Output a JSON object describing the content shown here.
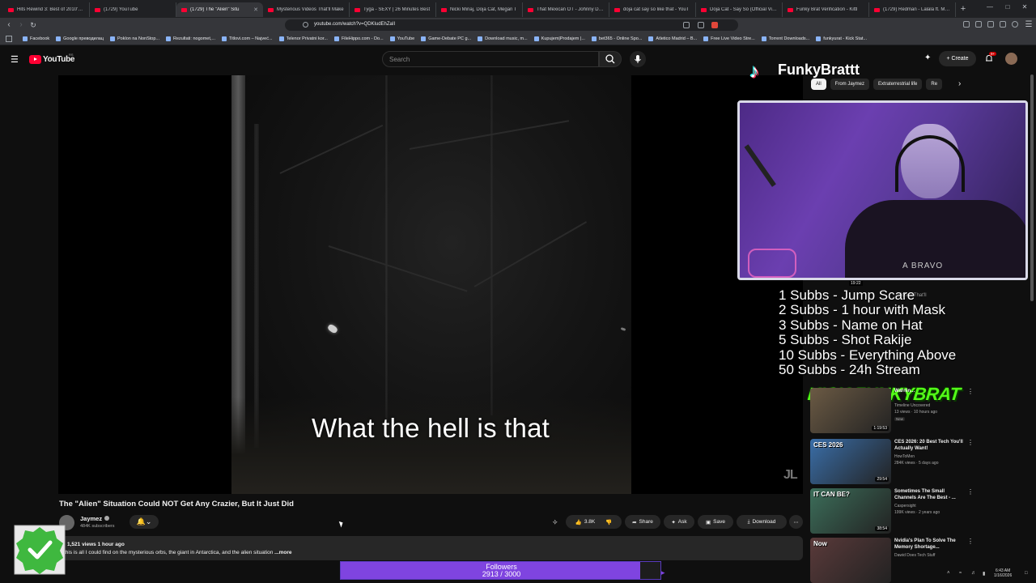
{
  "browser": {
    "tabs": [
      {
        "title": "Hits Rewind 3: Best of 2010's Hi",
        "active": false
      },
      {
        "title": "(1729) YouTube",
        "active": false
      },
      {
        "title": "(1729) The \"Alien\" Situ",
        "active": true
      },
      {
        "title": "Mysterious Videos That'll Make",
        "active": false
      },
      {
        "title": "Tyga - SEXY | 26 Minutes Best",
        "active": false
      },
      {
        "title": "Nicki Minaj, Doja Cat, Megan T",
        "active": false
      },
      {
        "title": "That Mexican OT - Johnny Dan",
        "active": false
      },
      {
        "title": "doja cat say so like that - YouT",
        "active": false
      },
      {
        "title": "Doja Cat - Say So (Official Vide",
        "active": false
      },
      {
        "title": "Funky Brat Verification - Kittl",
        "active": false
      },
      {
        "title": "(1729) Redman - Lalala ft. Meth",
        "active": false
      }
    ],
    "new_tab": "+",
    "url": "youtube.com/watch?v=QDKludEhZaII",
    "bookmarks": [
      "Facebook",
      "Google преводилац",
      "Poklon na NonStop...",
      "Rezultati: nogomet,...",
      "Titlovi.com – Najveć...",
      "Telenor Privatni kor...",
      "FileHippo.com - Do...",
      "YouTube",
      "Game-Debate PC g...",
      "Download music, m...",
      "Kupujem|Prodajem |...",
      "bet365 - Online Spo...",
      "Atletico Madrid – B...",
      "Free Live Video Stre...",
      "Torrent Downloads...",
      "funkyurat - Kick Stat..."
    ]
  },
  "youtube": {
    "logo_text": "YouTube",
    "region": "RS",
    "search_placeholder": "Search",
    "create_label": "+ Create",
    "notif_count": "9+",
    "video": {
      "subtitle": "What the hell is that",
      "watermark": "JL",
      "title": "The \"Alien\" Situation Could NOT Get Any Crazier, But It Just Did",
      "channel": "Jaymez",
      "subscribers": "484K subscribers",
      "likes": "3.8K",
      "share": "Share",
      "ask": "Ask",
      "save": "Save",
      "download": "Download",
      "views_time": "1,521 views  1 hour ago",
      "description": "this is all I could find on the mysterious orbs, the giant in Antarctica, and the alien situation",
      "more": "...more"
    },
    "chips": [
      "All",
      "From Jaymez",
      "Extraterrestrial life",
      "Re"
    ],
    "recommendations": [
      {
        "title": "Warnin...",
        "channel": "Timeline Uncovered",
        "meta": "13 views · 10 hours ago",
        "badge": "New",
        "duration": "1:19:53",
        "thumb": "#6b5a44"
      },
      {
        "title": "CES 2026: 20 Best Tech You'll Actually Want!",
        "channel": "HowToMen",
        "meta": "284K views · 5 days ago",
        "badge": "",
        "duration": "29:54",
        "thumb": "#3a6ea8"
      },
      {
        "title": "Sometimes The Small Channels Are The Best - ...",
        "channel": "Caspersight",
        "meta": "199K views · 2 years ago",
        "badge": "",
        "duration": "38:54",
        "thumb": "#3c6e5a"
      },
      {
        "title": "Nvidia's Plan To Solve The Memory Shortage...",
        "channel": "Dawid Does Tech Stuff",
        "meta": "",
        "badge": "",
        "duration": "",
        "thumb": "#5a3a3a"
      }
    ],
    "rec_first_partial": {
      "duration_top": "19:22",
      "title_top": "...Videos That'll"
    }
  },
  "overlay": {
    "tiktok_name": "FunkyBrattt",
    "shirt_text": "A BRAVO",
    "goals": [
      "1 Subbs - Jump Scare",
      "2 Subbs - 1 hour with Mask",
      "3 Subbs - Name on Hat",
      "5 Subbs - Shot Rakije",
      "10 Subbs - Everything Above",
      "50 Subbs - 24h Stream"
    ],
    "kick_banner": "KICK FUNKYBRAT",
    "followers_label": "Followers",
    "followers_count": "2913 / 3000",
    "followers_progress": 0.971,
    "thumb_texts": {
      "rec2": "CES 2026",
      "rec3": "IT CAN BE?",
      "rec4": "Now"
    }
  },
  "taskbar": {
    "time": "6:43 AM",
    "date": "1/16/2026"
  }
}
